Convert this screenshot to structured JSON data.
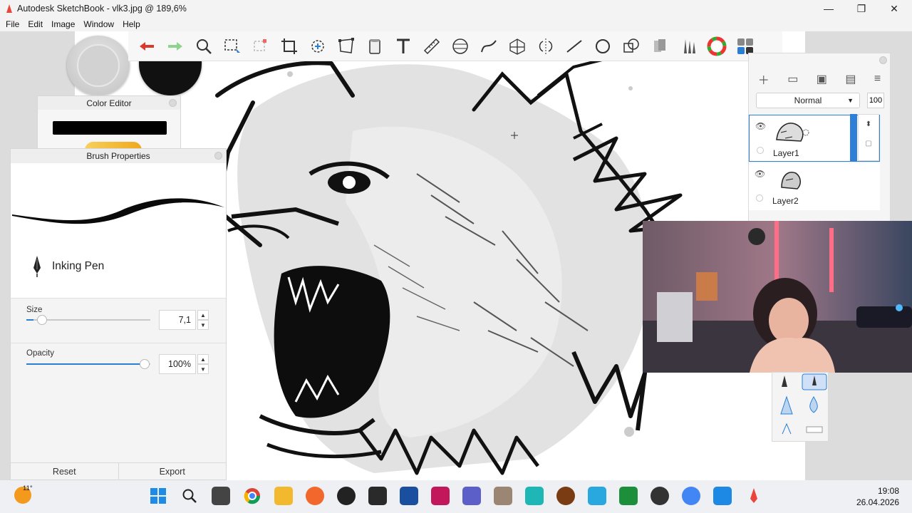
{
  "window": {
    "title": "Autodesk SketchBook - vlk3.jpg @ 189,6%",
    "min": "—",
    "max": "❐",
    "close": "✕"
  },
  "menu": [
    "File",
    "Edit",
    "Image",
    "Window",
    "Help"
  ],
  "toolbar": {
    "tools": [
      "undo-icon",
      "redo-icon",
      "zoom-icon",
      "select-icon",
      "lasso-icon",
      "crop-icon",
      "transform-icon",
      "distort-icon",
      "fill-icon",
      "text-icon",
      "ruler-icon",
      "ellipse-guide-icon",
      "french-curve-icon",
      "perspective-icon",
      "symmetry-icon",
      "stroke-icon",
      "ellipse-icon",
      "shapes-icon",
      "copic-icon",
      "brushes-icon",
      "color-wheel-icon",
      "brush-library-icon"
    ]
  },
  "color_editor": {
    "title": "Color Editor",
    "current_color": "#000000"
  },
  "brush_properties": {
    "title": "Brush Properties",
    "brush_name": "Inking Pen",
    "size": {
      "label": "Size",
      "value": "7,1",
      "fraction": 0.06
    },
    "opacity": {
      "label": "Opacity",
      "value": "100%",
      "fraction": 1.0
    },
    "reset": "Reset",
    "export": "Export"
  },
  "layers": {
    "blend_mode": "Normal",
    "opacity": "100",
    "items": [
      {
        "name": "Layer1",
        "active": true
      },
      {
        "name": "Layer2",
        "active": false
      }
    ]
  },
  "taskbar": {
    "temperature": "11°",
    "time": "19:08",
    "date": "26.04.2026"
  },
  "colors": {
    "accent": "#2a7fd4",
    "undo": "#d93a2b",
    "redo": "#8ed48e"
  }
}
